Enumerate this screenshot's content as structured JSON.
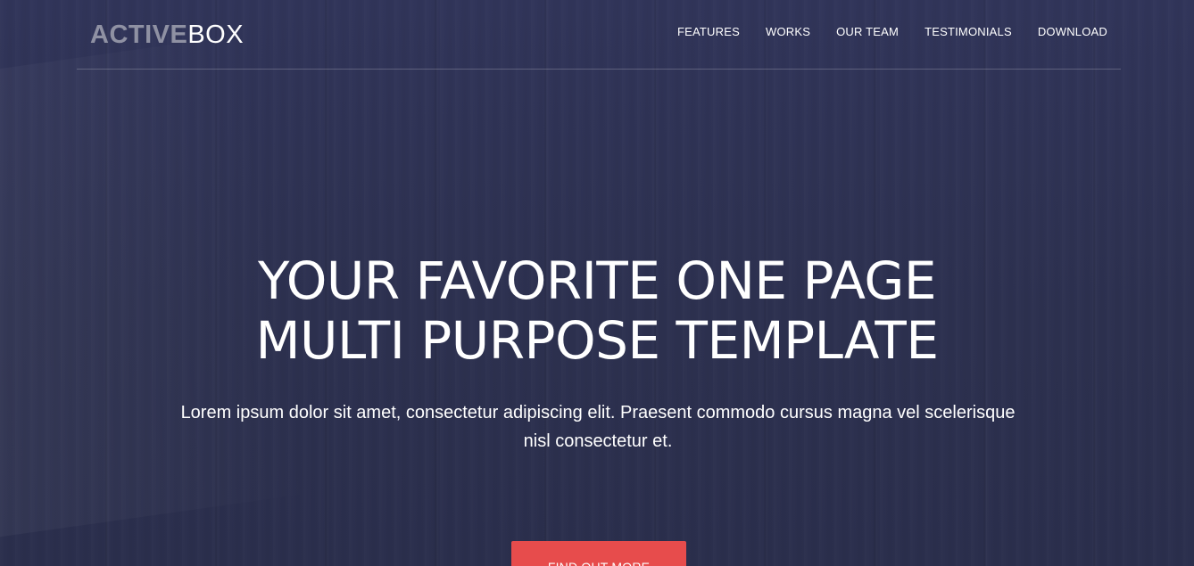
{
  "brand": {
    "bold": "ACTIVE",
    "light": "BOX"
  },
  "nav": {
    "items": [
      {
        "label": "FEATURES"
      },
      {
        "label": "WORKS"
      },
      {
        "label": "OUR TEAM"
      },
      {
        "label": "TESTIMONIALS"
      },
      {
        "label": "DOWNLOAD"
      }
    ]
  },
  "hero": {
    "headline_line1": "YOUR FAVORITE ONE PAGE",
    "headline_line2": "MULTI PURPOSE TEMPLATE",
    "description": "Lorem ipsum dolor sit amet, consectetur adipiscing elit. Praesent commodo cursus magna vel scelerisque nisl consectetur et.",
    "cta_label": "FIND OUT MORE"
  },
  "colors": {
    "background": "#2f3352",
    "accent": "#e74c4c",
    "logo_muted": "#8f91a3"
  }
}
